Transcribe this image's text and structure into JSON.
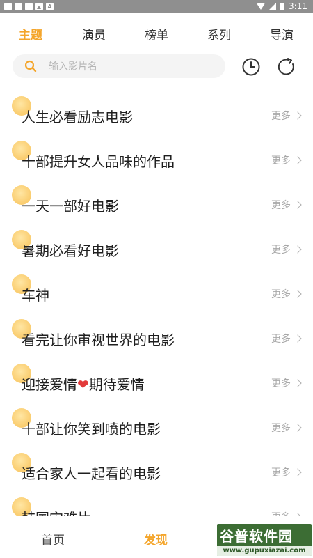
{
  "status_bar": {
    "time": "3:11"
  },
  "tabs": [
    {
      "label": "主题"
    },
    {
      "label": "演员"
    },
    {
      "label": "榜单"
    },
    {
      "label": "系列"
    },
    {
      "label": "导演"
    }
  ],
  "search": {
    "placeholder": "输入影片名"
  },
  "list": {
    "more_label": "更多",
    "items": [
      {
        "title": "人生必看励志电影"
      },
      {
        "title": "十部提升女人品味的作品"
      },
      {
        "title": "一天一部好电影"
      },
      {
        "title": "暑期必看好电影"
      },
      {
        "title": "车神"
      },
      {
        "title": "看完让你审视世界的电影"
      },
      {
        "title_before": "迎接爱情",
        "heart": "❤",
        "title_after": "期待爱情"
      },
      {
        "title": "十部让你笑到喷的电影"
      },
      {
        "title": "适合家人一起看的电影"
      },
      {
        "title": "韩国灾难片"
      }
    ]
  },
  "bottom_nav": [
    {
      "label": "首页"
    },
    {
      "label": "发现"
    }
  ],
  "watermark": {
    "main": "谷普软件园",
    "sub": "www.gupuxiazai.com"
  },
  "colors": {
    "accent": "#f4a52b",
    "status_bar": "#8f8f8f",
    "more_text": "#a8a8a8"
  }
}
